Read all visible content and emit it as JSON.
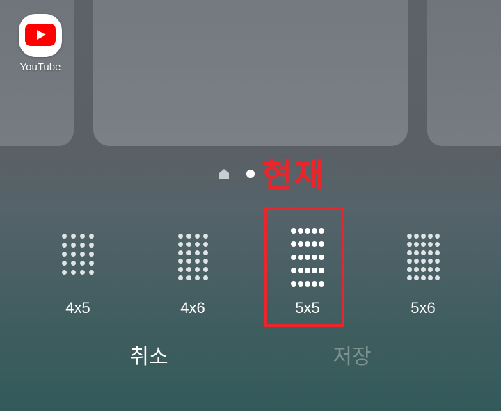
{
  "home": {
    "apps": [
      {
        "label": "YouTube",
        "icon": "youtube-icon"
      }
    ]
  },
  "annotation": {
    "label": "현재",
    "color": "#e8262b"
  },
  "grid_options": [
    {
      "label": "4x5",
      "cols": 4,
      "rows": 5,
      "selected": false
    },
    {
      "label": "4x6",
      "cols": 4,
      "rows": 6,
      "selected": false
    },
    {
      "label": "5x5",
      "cols": 5,
      "rows": 5,
      "selected": true
    },
    {
      "label": "5x6",
      "cols": 5,
      "rows": 6,
      "selected": false
    }
  ],
  "actions": {
    "cancel_label": "취소",
    "save_label": "저장"
  },
  "page_indicator": {
    "icons": [
      "home-indicator-icon",
      "page-dot"
    ],
    "current": 1
  }
}
